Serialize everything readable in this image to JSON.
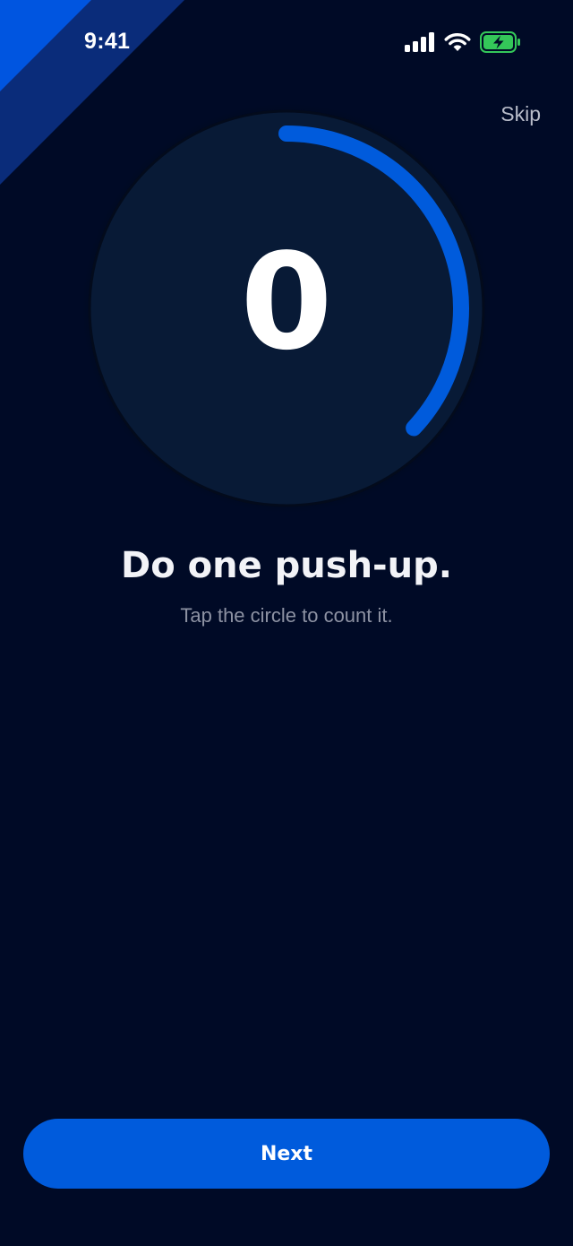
{
  "status_bar": {
    "time": "9:41"
  },
  "header": {
    "skip_label": "Skip"
  },
  "counter": {
    "value": "0",
    "progress_fraction": 0.37,
    "accent_color": "#005bdc",
    "face_color": "#081a36"
  },
  "prompt": {
    "title": "Do one push-up.",
    "subtitle": "Tap the circle to count it."
  },
  "footer": {
    "next_label": "Next"
  },
  "icons": {
    "signal": "cellular-signal-icon",
    "wifi": "wifi-icon",
    "battery": "battery-charging-icon"
  },
  "colors": {
    "background": "#000a26",
    "accent": "#005bdc",
    "battery_fill": "#34c759"
  }
}
